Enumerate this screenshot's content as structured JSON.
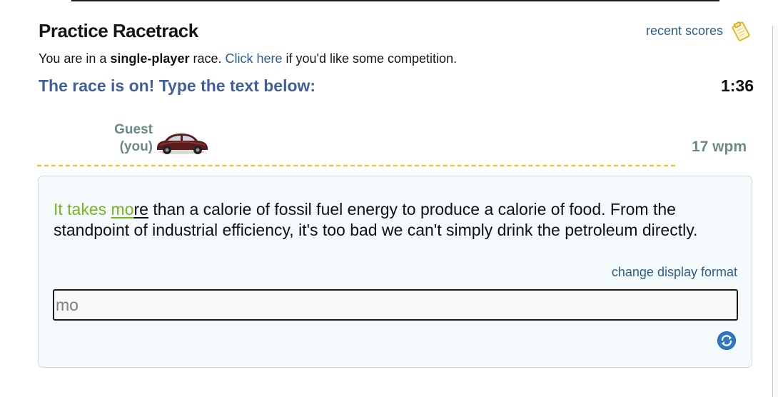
{
  "header": {
    "title": "Practice Racetrack",
    "recent_scores_label": "recent scores",
    "recent_scores_icon": "clipboard-icon"
  },
  "mode_line": {
    "prefix": "You are in a ",
    "mode": "single-player",
    "middle": " race. ",
    "link": "Click here",
    "suffix": " if you'd like some competition."
  },
  "race": {
    "status": "The race is on! Type the text below:",
    "timer": "1:36"
  },
  "player": {
    "name": "Guest",
    "tag": "(you)",
    "car_icon": "car-icon",
    "wpm": "17 wpm",
    "progress": 0.01,
    "track_color": "#f0c419"
  },
  "passage": {
    "typed": "It takes ",
    "current_typed": "mo",
    "current_rest": "re",
    "remaining": " than a calorie of fossil fuel energy to produce a calorie of food. From the standpoint of industrial efficiency, it's too bad we can't simply drink the petroleum directly.",
    "typed_color": "#7ab31f"
  },
  "controls": {
    "change_format_label": "change display format",
    "input_value": "mo",
    "refresh_icon": "refresh-icon"
  },
  "colors": {
    "heading_blue": "#41609a",
    "link_blue": "#2c5d8e",
    "player_gray": "#6b8a88",
    "panel_bg": "#f4f9fc"
  }
}
